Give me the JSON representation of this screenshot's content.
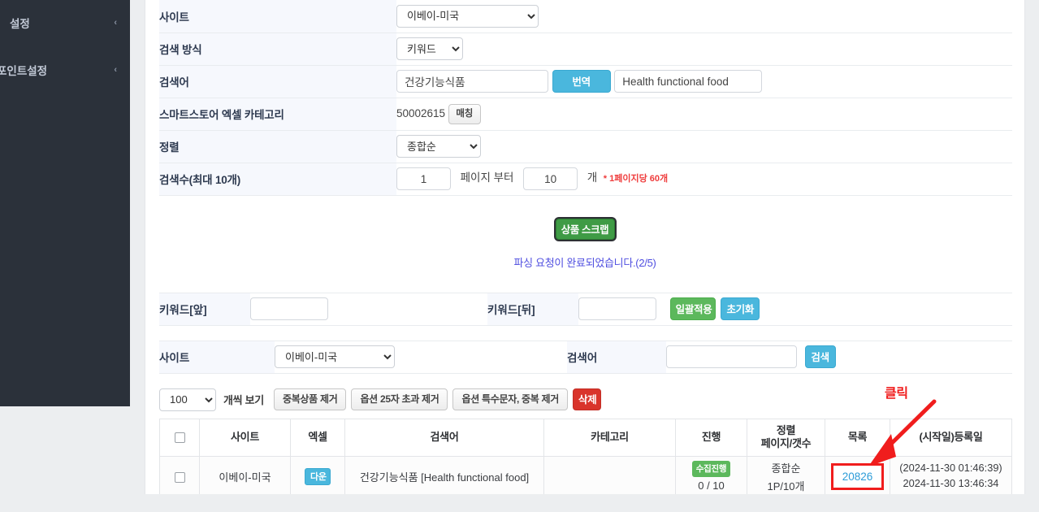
{
  "sidebar": {
    "items": [
      {
        "label": "설정",
        "chevron": "‹"
      },
      {
        "label": "포인트설정",
        "chevron": "‹"
      }
    ]
  },
  "settings_form": {
    "rows": [
      {
        "label": "사이트"
      },
      {
        "label": "검색 방식"
      },
      {
        "label": "검색어"
      },
      {
        "label": "스마트스토어 엑셀 카테고리"
      },
      {
        "label": "정렬"
      },
      {
        "label": "검색수(최대 10개)"
      }
    ],
    "site_select": {
      "value": "이베이-미국",
      "options": [
        "이베이-미국"
      ]
    },
    "method_select": {
      "value": "키워드",
      "options": [
        "키워드"
      ]
    },
    "keyword_input": {
      "value": "건강기능식품",
      "placeholder": ""
    },
    "translate_button": "번역",
    "translated_input": {
      "value": "Health functional food",
      "placeholder": ""
    },
    "category_code": "50002615",
    "match_button": "매칭",
    "sort_select": {
      "value": "종합순",
      "options": [
        "종합순"
      ]
    },
    "page_from": "1",
    "page_from_suffix": "페이지 부터",
    "page_count": "10",
    "count_suffix": "개",
    "count_note": "* 1페이지당 60개"
  },
  "scrap": {
    "button_label": "상품 스크랩",
    "status_message": "파싱 요청이 완료되었습니다.(2/5)"
  },
  "keyword_tools": {
    "front_label": "키워드[앞]",
    "front_value": "",
    "back_label": "키워드[뒤]",
    "back_value": "",
    "apply_all_button": "일괄적용",
    "reset_button": "초기화"
  },
  "search_bar": {
    "site_label": "사이트",
    "site_select": {
      "value": "이베이-미국",
      "options": [
        "이베이-미국"
      ]
    },
    "keyword_label": "검색어",
    "keyword_value": "",
    "search_button": "검색"
  },
  "toolbar": {
    "per_page_select": {
      "value": "100",
      "options": [
        "100"
      ]
    },
    "per_page_suffix": "개씩 보기",
    "remove_dup_products": "중복상품 제거",
    "remove_option_over25": "옵션 25자 초과 제거",
    "remove_option_special": "옵션 특수문자, 중복 제거",
    "delete_button": "삭제"
  },
  "grid": {
    "headers": [
      "",
      "사이트",
      "엑셀",
      "검색어",
      "카테고리",
      "진행",
      "정렬\n페이지/갯수",
      "목록",
      "(시작일)등록일"
    ],
    "header_sort_line1": "정렬",
    "header_sort_line2": "페이지/갯수",
    "rows": [
      {
        "site": "이베이-미국",
        "excel_button": "다운",
        "keyword": "건강기능식품 [Health functional food]",
        "category": "",
        "progress_badge": "수집진행",
        "progress_count": "0 / 10",
        "sort_name": "종합순",
        "sort_detail": "1P/10개",
        "list_count": "20826",
        "date_start": "(2024-11-30 01:46:39)",
        "date_reg": "2024-11-30 13:46:34"
      }
    ]
  },
  "annotation": {
    "label": "클릭",
    "color": "#f01d1d"
  }
}
